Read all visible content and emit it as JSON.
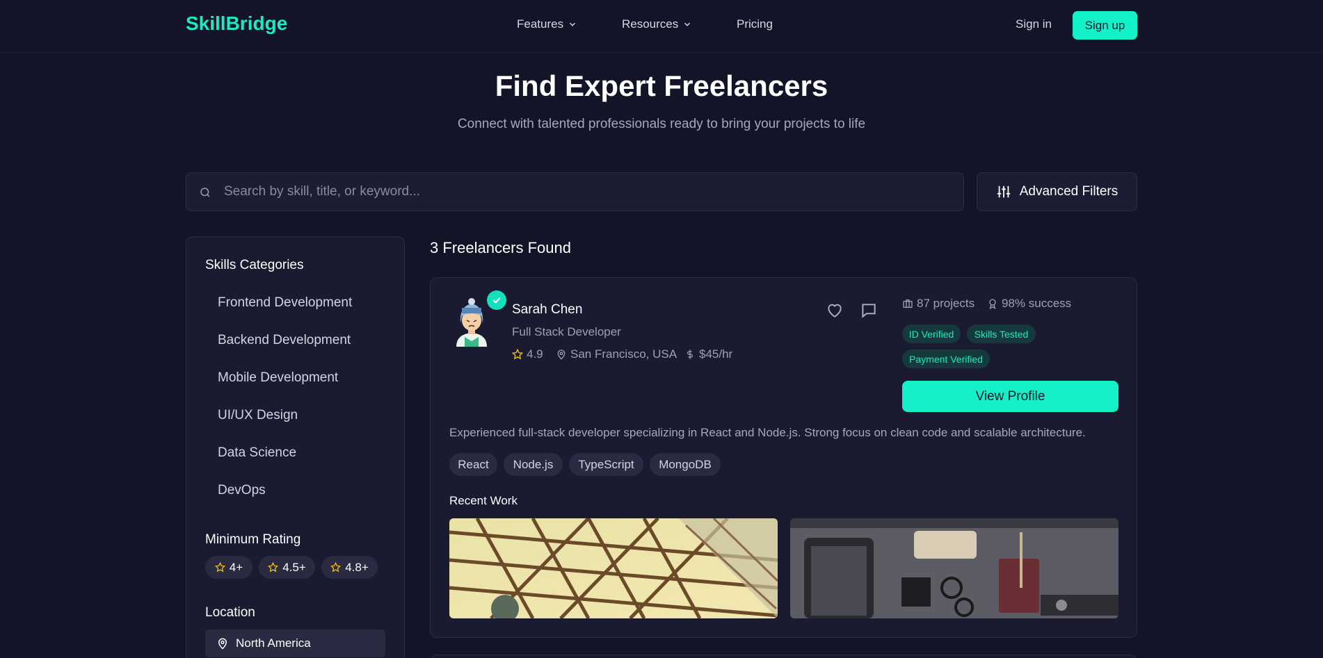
{
  "nav": {
    "logo": "SkillBridge",
    "links": [
      "Features",
      "Resources",
      "Pricing"
    ],
    "signin": "Sign in",
    "signup": "Sign up"
  },
  "hero": {
    "title": "Find Expert Freelancers",
    "subtitle": "Connect with talented professionals ready to bring your projects to life"
  },
  "search": {
    "placeholder": "Search by skill, title, or keyword...",
    "advanced_filters": "Advanced Filters"
  },
  "sidebar": {
    "skills_heading": "Skills Categories",
    "categories": [
      "Frontend Development",
      "Backend Development",
      "Mobile Development",
      "UI/UX Design",
      "Data Science",
      "DevOps"
    ],
    "rating_heading": "Minimum Rating",
    "ratings": [
      "4+",
      "4.5+",
      "4.8+"
    ],
    "location_heading": "Location",
    "location_value": "North America"
  },
  "results": {
    "count_label": "3 Freelancers Found",
    "freelancers": [
      {
        "name": "Sarah Chen",
        "title": "Full Stack Developer",
        "rating": "4.9",
        "location": "San Francisco, USA",
        "rate": "$45/hr",
        "projects": "87 projects",
        "success": "98% success",
        "badges": [
          "ID Verified",
          "Skills Tested",
          "Payment Verified"
        ],
        "view_profile": "View Profile",
        "description": "Experienced full-stack developer specializing in React and Node.js. Strong focus on clean code and scalable architecture.",
        "skills": [
          "React",
          "Node.js",
          "TypeScript",
          "MongoDB"
        ],
        "recent_work_label": "Recent Work"
      }
    ]
  },
  "colors": {
    "accent": "#14f0c8",
    "background": "#141428",
    "card": "#1a1a30",
    "star": "#f5c518"
  }
}
